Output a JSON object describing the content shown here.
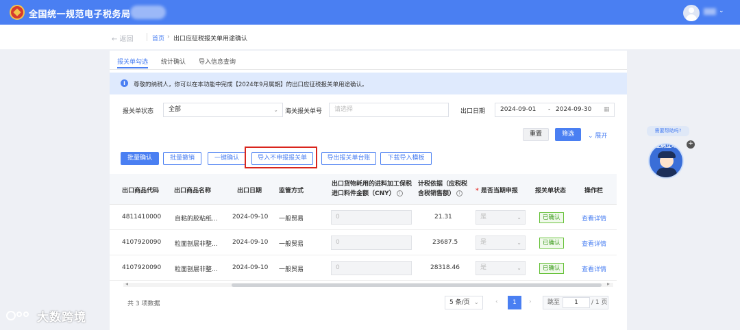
{
  "header": {
    "title": "全国统一规范电子税务局",
    "user_caret": "⌄"
  },
  "breadcrumb": {
    "back": "← 返回",
    "home": "首页",
    "separator": "›",
    "current": "出口应征税报关单用途确认"
  },
  "tabs": [
    {
      "label": "报关单勾选",
      "active": true
    },
    {
      "label": "统计确认",
      "active": false
    },
    {
      "label": "导入信息查询",
      "active": false
    }
  ],
  "notice": {
    "icon": "i",
    "text": "尊敬的纳税人，你可以在本功能中完成【2024年9月属期】的出口应征税报关单用途确认。"
  },
  "filters": {
    "status_label": "报关单状态",
    "status_value": "全部",
    "customs_no_label": "海关报关单号",
    "customs_no_placeholder": "请选择",
    "date_label": "出口日期",
    "date_start": "2024-09-01",
    "date_sep": "-",
    "date_end": "2024-09-30",
    "reset": "重置",
    "filter": "筛选",
    "expand": "⌄ 展开"
  },
  "actions": {
    "batch_confirm": "批量确认",
    "batch_revoke": "批量撤销",
    "one_click_confirm": "一键确认",
    "import_not_declared": "导入不申报报关单",
    "export_ledger": "导出报关单台账",
    "download_template": "下载导入模板"
  },
  "table": {
    "headers": {
      "code": "出口商品代码",
      "name": "出口商品名称",
      "date": "出口日期",
      "supervision": "监管方式",
      "import_amount_1": "出口货物耗用的进料加工保税",
      "import_amount_2": "进口料件金额（CNY）",
      "tax_basis_1": "计税依据（应税税",
      "tax_basis_2": "含税销售额）",
      "declare_star": "*",
      "declare": "是否当期申报",
      "status": "报关单状态",
      "op": "操作栏"
    },
    "rows": [
      {
        "code": "4811410000",
        "name": "自粘的胶粘纸...",
        "date": "2024-09-10",
        "supervision": "一般贸易",
        "import_amount": "0",
        "tax_basis": "21.31",
        "declare": "是",
        "status": "已确认",
        "op": "查看详情"
      },
      {
        "code": "4107920090",
        "name": "粒面剖层非整...",
        "date": "2024-09-10",
        "supervision": "一般贸易",
        "import_amount": "0",
        "tax_basis": "23687.5",
        "declare": "是",
        "status": "已确认",
        "op": "查看详情"
      },
      {
        "code": "4107920090",
        "name": "粒面剖层非整...",
        "date": "2024-09-10",
        "supervision": "一般贸易",
        "import_amount": "0",
        "tax_basis": "28318.46",
        "declare": "是",
        "status": "已确认",
        "op": "查看详情"
      }
    ]
  },
  "pagination": {
    "total": "共 3 项数据",
    "page_size": "5 条/页",
    "prev": "‹",
    "current_page": "1",
    "next": "›",
    "jump_prefix": "跳至",
    "jump_value": "1",
    "jump_suffix": "/ 1 页"
  },
  "assistant": {
    "bubble": "需要帮助吗?",
    "label": "征纳互动",
    "close": "+"
  },
  "watermark": "大数跨境",
  "colors": {
    "brand": "#4a7ff2",
    "highlight": "#d9251d",
    "confirmed": "#67c23a"
  }
}
